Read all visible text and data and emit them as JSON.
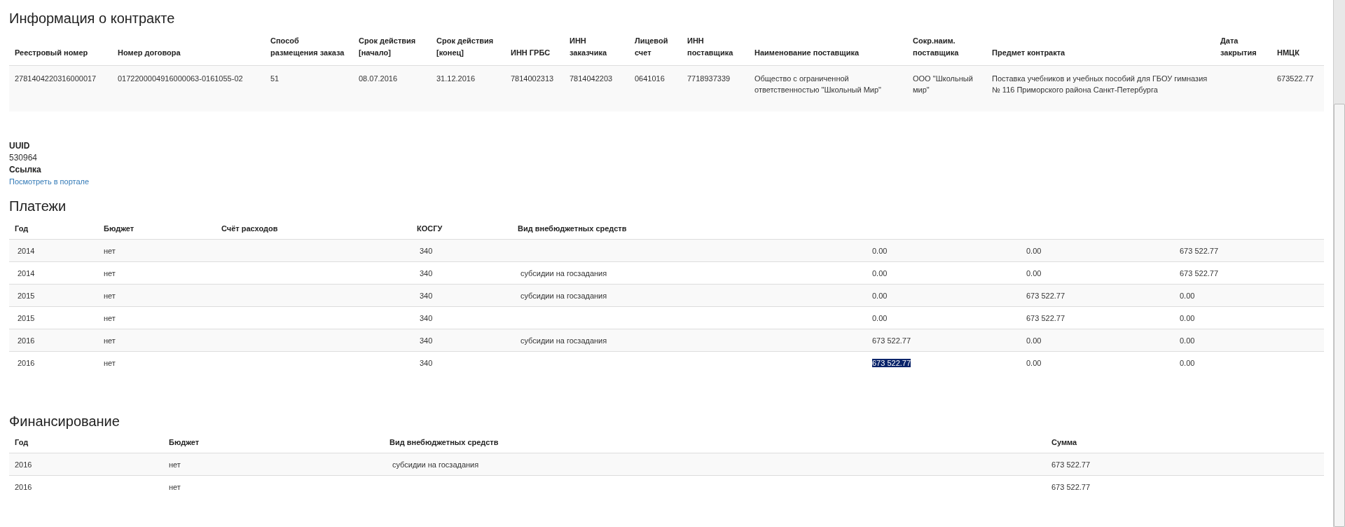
{
  "contract": {
    "title": "Информация о контракте",
    "columns": [
      "Реестровый номер",
      "Номер договора",
      "Способ размещения заказа",
      "Срок действия [начало]",
      "Срок действия [конец]",
      "ИНН ГРБС",
      "ИНН заказчика",
      "Лицевой счет",
      "ИНН поставщика",
      "Наименование поставщика",
      "Сокр.наим. поставщика",
      "Предмет контракта",
      "Дата закрытия",
      "НМЦК"
    ],
    "rows": [
      [
        "2781404220316000017",
        "0172200004916000063-0161055-02",
        "51",
        "08.07.2016",
        "31.12.2016",
        "7814002313",
        "7814042203",
        "0641016",
        "7718937339",
        "Общество с ограниченной ответственностью \"Школьный Мир\"",
        "ООО \"Школьный мир\"",
        "Поставка учебников и учебных пособий для ГБОУ гимназия № 116 Приморского района Санкт-Петербурга",
        "",
        "673522.77"
      ]
    ]
  },
  "details": [
    {
      "label": "UUID",
      "value": "530964",
      "kind": "text"
    },
    {
      "label": "Ссылка",
      "value": "Посмотреть в портале",
      "kind": "link"
    }
  ],
  "payments": {
    "title": "Платежи",
    "columns": [
      "Год",
      "Бюджет",
      "Счёт расходов",
      "КОСГУ",
      "Вид внебюджетных средств"
    ],
    "rows": [
      {
        "year": "2014",
        "budget": "нет",
        "kosgu": "340",
        "extrabudget_type": "",
        "amounts": [
          {
            "value": "0.00",
            "highlighted": false
          },
          {
            "value": "0.00",
            "highlighted": false
          },
          {
            "value": "673 522.77",
            "highlighted": false
          }
        ]
      },
      {
        "year": "2014",
        "budget": "нет",
        "kosgu": "340",
        "extrabudget_type": "субсидии на госзадания",
        "amounts": [
          {
            "value": "0.00",
            "highlighted": false
          },
          {
            "value": "0.00",
            "highlighted": false
          },
          {
            "value": "673 522.77",
            "highlighted": false
          }
        ]
      },
      {
        "year": "2015",
        "budget": "нет",
        "kosgu": "340",
        "extrabudget_type": "субсидии на госзадания",
        "amounts": [
          {
            "value": "0.00",
            "highlighted": false
          },
          {
            "value": "673 522.77",
            "highlighted": false
          },
          {
            "value": "0.00",
            "highlighted": false
          }
        ]
      },
      {
        "year": "2015",
        "budget": "нет",
        "kosgu": "340",
        "extrabudget_type": "",
        "amounts": [
          {
            "value": "0.00",
            "highlighted": false
          },
          {
            "value": "673 522.77",
            "highlighted": false
          },
          {
            "value": "0.00",
            "highlighted": false
          }
        ]
      },
      {
        "year": "2016",
        "budget": "нет",
        "kosgu": "340",
        "extrabudget_type": "субсидии на госзадания",
        "amounts": [
          {
            "value": "673 522.77",
            "highlighted": false
          },
          {
            "value": "0.00",
            "highlighted": false
          },
          {
            "value": "0.00",
            "highlighted": false
          }
        ]
      },
      {
        "year": "2016",
        "budget": "нет",
        "kosgu": "340",
        "extrabudget_type": "",
        "amounts": [
          {
            "value": "673 522.77",
            "highlighted": true
          },
          {
            "value": "0.00",
            "highlighted": false
          },
          {
            "value": "0.00",
            "highlighted": false
          }
        ]
      }
    ]
  },
  "financing": {
    "title": "Финансирование",
    "columns": [
      "Год",
      "Бюджет",
      "Вид внебюджетных средств",
      "Сумма"
    ],
    "rows": [
      [
        "2016",
        "нет",
        "субсидии на госзадания",
        "673 522.77"
      ],
      [
        "2016",
        "нет",
        "",
        "673 522.77"
      ]
    ]
  }
}
